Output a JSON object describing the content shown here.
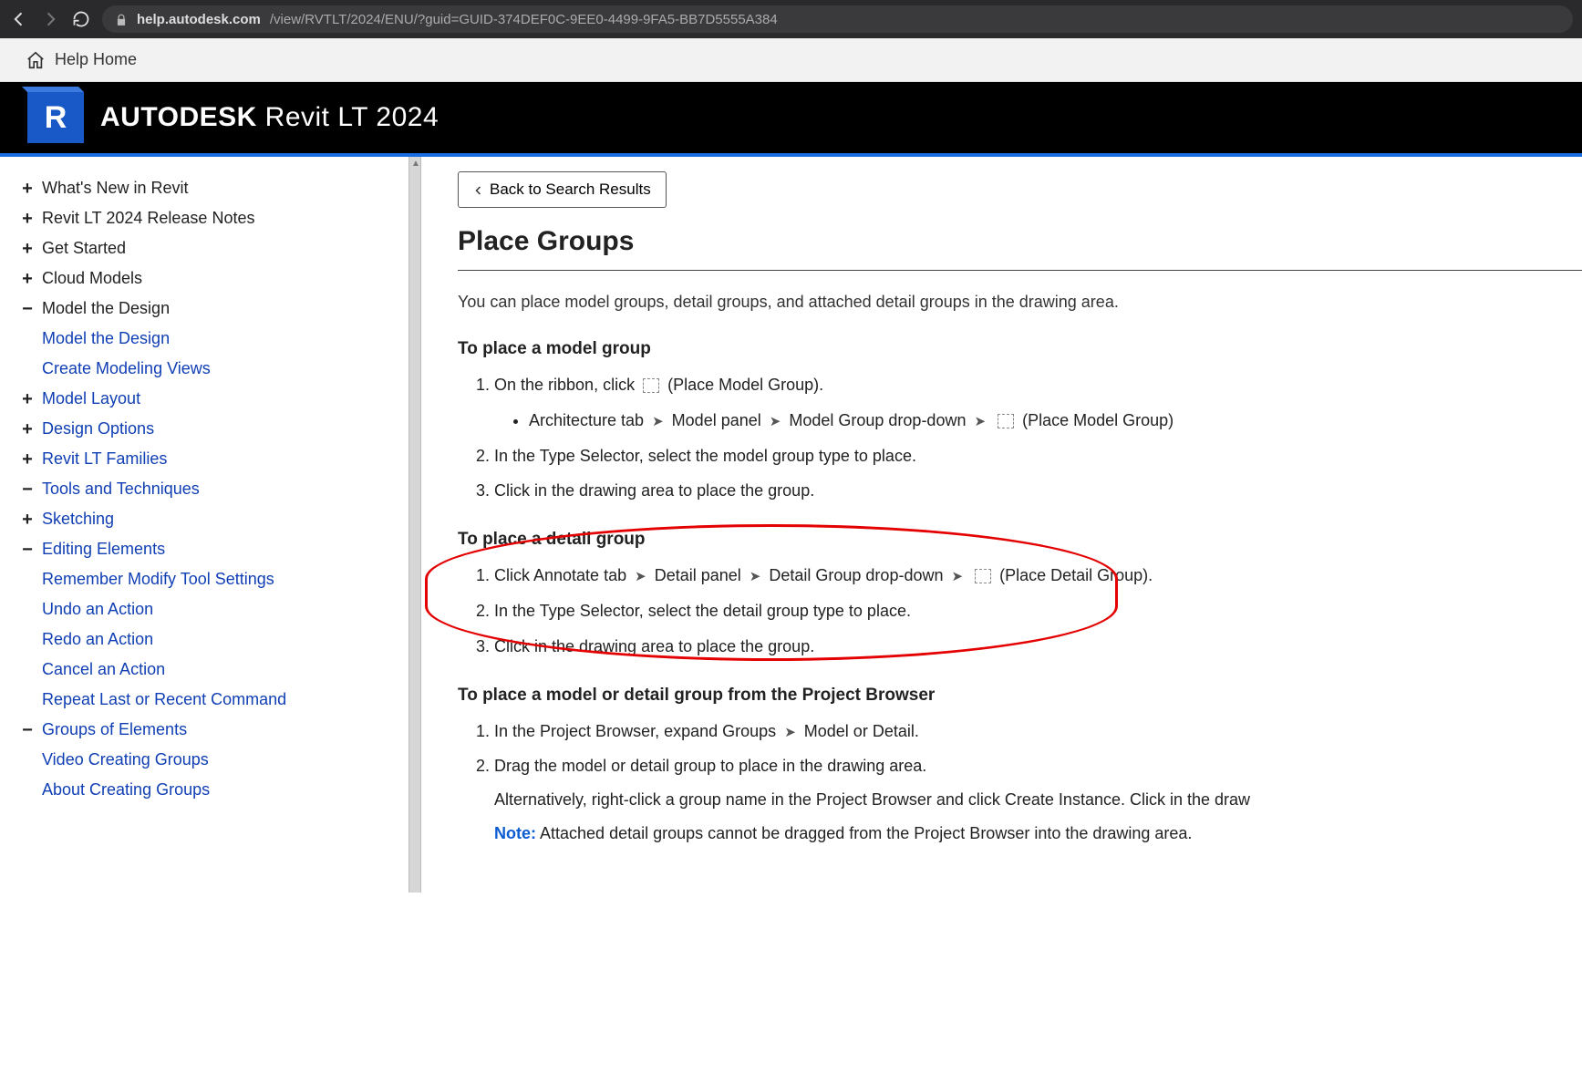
{
  "browser": {
    "url_host": "help.autodesk.com",
    "url_path": "/view/RVTLT/2024/ENU/?guid=GUID-374DEF0C-9EE0-4499-9FA5-BB7D5555A384"
  },
  "help_home": {
    "label": "Help Home"
  },
  "brand": {
    "company": "AUTODESK",
    "product": "Revit LT 2024",
    "logo_letter": "R"
  },
  "sidebar": {
    "items": [
      {
        "label": "What's New in Revit",
        "toggle": "+",
        "indent": 0,
        "root": true
      },
      {
        "label": "Revit LT 2024 Release Notes",
        "toggle": "+",
        "indent": 0,
        "root": true
      },
      {
        "label": "Get Started",
        "toggle": "+",
        "indent": 0,
        "root": true
      },
      {
        "label": "Cloud Models",
        "toggle": "+",
        "indent": 0,
        "root": true
      },
      {
        "label": "Model the Design",
        "toggle": "−",
        "indent": 0,
        "root": true
      },
      {
        "label": "Model the Design",
        "toggle": "",
        "indent": 1,
        "root": false
      },
      {
        "label": "Create Modeling Views",
        "toggle": "",
        "indent": 1,
        "root": false
      },
      {
        "label": "Model Layout",
        "toggle": "+",
        "indent": 1,
        "root": false
      },
      {
        "label": "Design Options",
        "toggle": "+",
        "indent": 1,
        "root": false
      },
      {
        "label": "Revit LT Families",
        "toggle": "+",
        "indent": 1,
        "root": false
      },
      {
        "label": "Tools and Techniques",
        "toggle": "−",
        "indent": 1,
        "root": false
      },
      {
        "label": "Sketching",
        "toggle": "+",
        "indent": 2,
        "root": false
      },
      {
        "label": "Editing Elements",
        "toggle": "−",
        "indent": 2,
        "root": false
      },
      {
        "label": "Remember Modify Tool Settings",
        "toggle": "",
        "indent": 3,
        "root": false
      },
      {
        "label": "Undo an Action",
        "toggle": "",
        "indent": 3,
        "root": false
      },
      {
        "label": "Redo an Action",
        "toggle": "",
        "indent": 3,
        "root": false
      },
      {
        "label": "Cancel an Action",
        "toggle": "",
        "indent": 3,
        "root": false
      },
      {
        "label": "Repeat Last or Recent Command",
        "toggle": "",
        "indent": 3,
        "root": false
      },
      {
        "label": "Groups of Elements",
        "toggle": "−",
        "indent": 3,
        "root": false
      },
      {
        "label": "Video Creating Groups",
        "toggle": "",
        "indent": 4,
        "root": false
      },
      {
        "label": "About Creating Groups",
        "toggle": "",
        "indent": 4,
        "root": false
      }
    ]
  },
  "main": {
    "back_label": "Back to Search Results",
    "title": "Place Groups",
    "intro": "You can place model groups, detail groups, and attached detail groups in the drawing area.",
    "section1": {
      "heading": "To place a model group",
      "step1_a": "On the ribbon, click",
      "step1_b": "(Place Model Group).",
      "bullet_parts": {
        "a": "Architecture tab",
        "b": "Model panel",
        "c": "Model Group drop-down",
        "d": "(Place Model Group)"
      },
      "step2": "In the Type Selector, select the model group type to place.",
      "step3": "Click in the drawing area to place the group."
    },
    "section2": {
      "heading": "To place a detail group",
      "step1_parts": {
        "a": "Click Annotate tab",
        "b": "Detail panel",
        "c": "Detail Group drop-down",
        "d": "(Place Detail Group)."
      },
      "step2": "In the Type Selector, select the detail group type to place.",
      "step3": "Click in the drawing area to place the group."
    },
    "section3": {
      "heading": "To place a model or detail group from the Project Browser",
      "step1_a": "In the Project Browser, expand Groups",
      "step1_b": "Model or Detail.",
      "step2": "Drag the model or detail group to place in the drawing area.",
      "alt": "Alternatively, right-click a group name in the Project Browser and click Create Instance. Click in the draw",
      "note_label": "Note:",
      "note_text": "Attached detail groups cannot be dragged from the Project Browser into the drawing area."
    }
  }
}
